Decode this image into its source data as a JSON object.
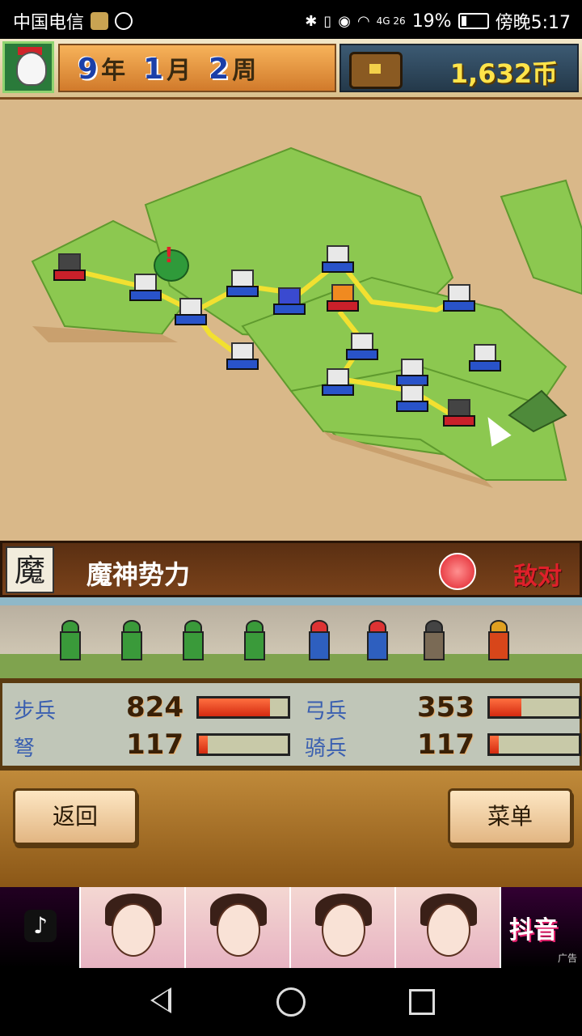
{
  "status_bar": {
    "carrier": "中国电信",
    "battery": "19%",
    "time": "傍晚5:17",
    "network": "4G 26"
  },
  "hud": {
    "year_num": "9",
    "year_unit": "年",
    "month_num": "1",
    "month_unit": "月",
    "week_num": "2",
    "week_unit": "周",
    "coins": "1,632币"
  },
  "faction": {
    "glyph": "魔",
    "name": "魔神势力",
    "status": "敌对"
  },
  "stats": {
    "infantry": {
      "label": "步兵",
      "value": "824",
      "level": 0.8
    },
    "archer": {
      "label": "弓兵",
      "value": "353",
      "level": 0.35
    },
    "crossbow": {
      "label": "弩",
      "value": "117",
      "level": 0.1
    },
    "cavalry": {
      "label": "骑兵",
      "value": "117",
      "level": 0.1
    }
  },
  "buttons": {
    "back": "返回",
    "menu": "菜单"
  },
  "ad": {
    "brand": "抖音",
    "tag": "广告"
  },
  "colors": {
    "enemy": "#e0202a",
    "coin": "#ffe44a",
    "label_blue": "#3a5fb0"
  }
}
